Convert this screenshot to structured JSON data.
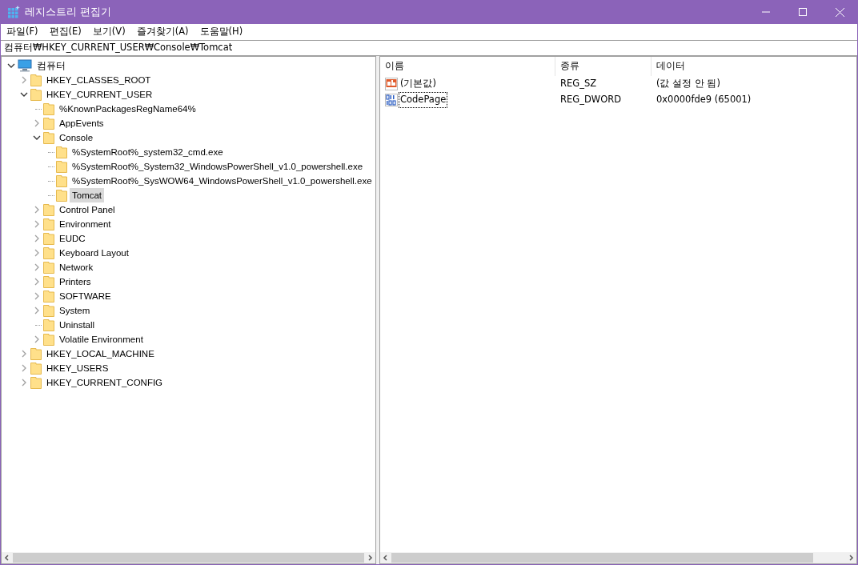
{
  "window": {
    "title": "레지스트리 편집기"
  },
  "menu": [
    "파일(F)",
    "편집(E)",
    "보기(V)",
    "즐겨찾기(A)",
    "도움말(H)"
  ],
  "address": "컴퓨터₩HKEY_CURRENT_USER₩Console₩Tomcat",
  "tree": [
    {
      "label": "컴퓨터",
      "kind": "computer",
      "expandable": true,
      "expanded": true,
      "selected": false,
      "children": [
        {
          "label": "HKEY_CLASSES_ROOT",
          "kind": "folder",
          "expandable": true,
          "expanded": false,
          "selected": false
        },
        {
          "label": "HKEY_CURRENT_USER",
          "kind": "folder",
          "expandable": true,
          "expanded": true,
          "selected": false,
          "children": [
            {
              "label": "%KnownPackagesRegName64%",
              "kind": "folder",
              "expandable": false,
              "expanded": false,
              "selected": false
            },
            {
              "label": "AppEvents",
              "kind": "folder",
              "expandable": true,
              "expanded": false,
              "selected": false
            },
            {
              "label": "Console",
              "kind": "folder",
              "expandable": true,
              "expanded": true,
              "selected": false,
              "children": [
                {
                  "label": "%SystemRoot%_system32_cmd.exe",
                  "kind": "folder",
                  "expandable": false,
                  "expanded": false,
                  "selected": false
                },
                {
                  "label": "%SystemRoot%_System32_WindowsPowerShell_v1.0_powershell.exe",
                  "kind": "folder",
                  "expandable": false,
                  "expanded": false,
                  "selected": false
                },
                {
                  "label": "%SystemRoot%_SysWOW64_WindowsPowerShell_v1.0_powershell.exe",
                  "kind": "folder",
                  "expandable": false,
                  "expanded": false,
                  "selected": false
                },
                {
                  "label": "Tomcat",
                  "kind": "folder",
                  "expandable": false,
                  "expanded": false,
                  "selected": true
                }
              ]
            },
            {
              "label": "Control Panel",
              "kind": "folder",
              "expandable": true,
              "expanded": false,
              "selected": false
            },
            {
              "label": "Environment",
              "kind": "folder",
              "expandable": true,
              "expanded": false,
              "selected": false
            },
            {
              "label": "EUDC",
              "kind": "folder",
              "expandable": true,
              "expanded": false,
              "selected": false
            },
            {
              "label": "Keyboard Layout",
              "kind": "folder",
              "expandable": true,
              "expanded": false,
              "selected": false
            },
            {
              "label": "Network",
              "kind": "folder",
              "expandable": true,
              "expanded": false,
              "selected": false
            },
            {
              "label": "Printers",
              "kind": "folder",
              "expandable": true,
              "expanded": false,
              "selected": false
            },
            {
              "label": "SOFTWARE",
              "kind": "folder",
              "expandable": true,
              "expanded": false,
              "selected": false
            },
            {
              "label": "System",
              "kind": "folder",
              "expandable": true,
              "expanded": false,
              "selected": false
            },
            {
              "label": "Uninstall",
              "kind": "folder",
              "expandable": false,
              "expanded": false,
              "selected": false
            },
            {
              "label": "Volatile Environment",
              "kind": "folder",
              "expandable": true,
              "expanded": false,
              "selected": false
            }
          ]
        },
        {
          "label": "HKEY_LOCAL_MACHINE",
          "kind": "folder",
          "expandable": true,
          "expanded": false,
          "selected": false
        },
        {
          "label": "HKEY_USERS",
          "kind": "folder",
          "expandable": true,
          "expanded": false,
          "selected": false
        },
        {
          "label": "HKEY_CURRENT_CONFIG",
          "kind": "folder",
          "expandable": true,
          "expanded": false,
          "selected": false
        }
      ]
    }
  ],
  "values": {
    "columns": [
      "이름",
      "종류",
      "데이터"
    ],
    "rows": [
      {
        "kind": "string",
        "name": "(기본값)",
        "type": "REG_SZ",
        "data": "(값 설정 안 됨)",
        "focused": false
      },
      {
        "kind": "binary",
        "name": "CodePage",
        "type": "REG_DWORD",
        "data": "0x0000fde9 (65001)",
        "focused": true
      }
    ]
  }
}
